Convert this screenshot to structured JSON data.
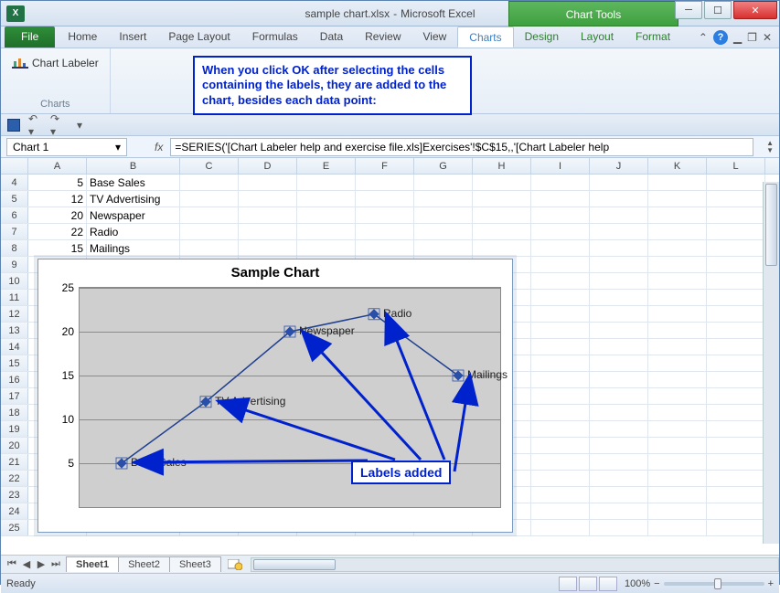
{
  "window": {
    "title_doc": "sample chart.xlsx",
    "title_app": "Microsoft Excel",
    "chart_tools_label": "Chart Tools"
  },
  "ribbon": {
    "file": "File",
    "tabs": [
      "Home",
      "Insert",
      "Page Layout",
      "Formulas",
      "Data",
      "Review",
      "View",
      "Charts"
    ],
    "ctx_tabs": [
      "Design",
      "Layout",
      "Format"
    ],
    "group": {
      "chart_labeler": "Chart Labeler",
      "group_label": "Charts"
    }
  },
  "callout_top": "When you click OK after selecting the cells containing the labels, they are added to the chart, besides each data point:",
  "qat": {
    "save": "Save",
    "undo": "Undo",
    "redo": "Redo"
  },
  "namebox": {
    "value": "Chart 1"
  },
  "formula": {
    "fx": "fx",
    "value": "=SERIES('[Chart Labeler help and exercise file.xls]Exercises'!$C$15,,'[Chart Labeler help"
  },
  "columns": {
    "A": "A",
    "B": "B",
    "C": "C",
    "D": "D",
    "E": "E",
    "F": "F",
    "G": "G",
    "H": "H",
    "I": "I",
    "J": "J",
    "K": "K",
    "L": "L"
  },
  "data_rows": [
    {
      "n": "4",
      "A": "5",
      "B": "Base Sales"
    },
    {
      "n": "5",
      "A": "12",
      "B": "TV Advertising"
    },
    {
      "n": "6",
      "A": "20",
      "B": "Newspaper"
    },
    {
      "n": "7",
      "A": "22",
      "B": "Radio"
    },
    {
      "n": "8",
      "A": "15",
      "B": "Mailings"
    }
  ],
  "blank_rows": [
    "9",
    "10",
    "11",
    "12",
    "13",
    "14",
    "15",
    "16",
    "17",
    "18",
    "19",
    "20",
    "21",
    "22",
    "23",
    "24",
    "25"
  ],
  "chart_data": {
    "type": "line",
    "title": "Sample Chart",
    "x": [
      1,
      2,
      3,
      4,
      5
    ],
    "values": [
      5,
      12,
      20,
      22,
      15
    ],
    "labels": [
      "Base Sales",
      "TV Advertising",
      "Newspaper",
      "Radio",
      "Mailings"
    ],
    "ylim": [
      0,
      25
    ],
    "yticks": [
      5,
      10,
      15,
      20,
      25
    ],
    "xlabel": "",
    "ylabel": ""
  },
  "callout_labels": "Labels added",
  "sheets": {
    "s1": "Sheet1",
    "s2": "Sheet2",
    "s3": "Sheet3"
  },
  "status": {
    "ready": "Ready",
    "zoom": "100%",
    "minus": "−",
    "plus": "+"
  }
}
